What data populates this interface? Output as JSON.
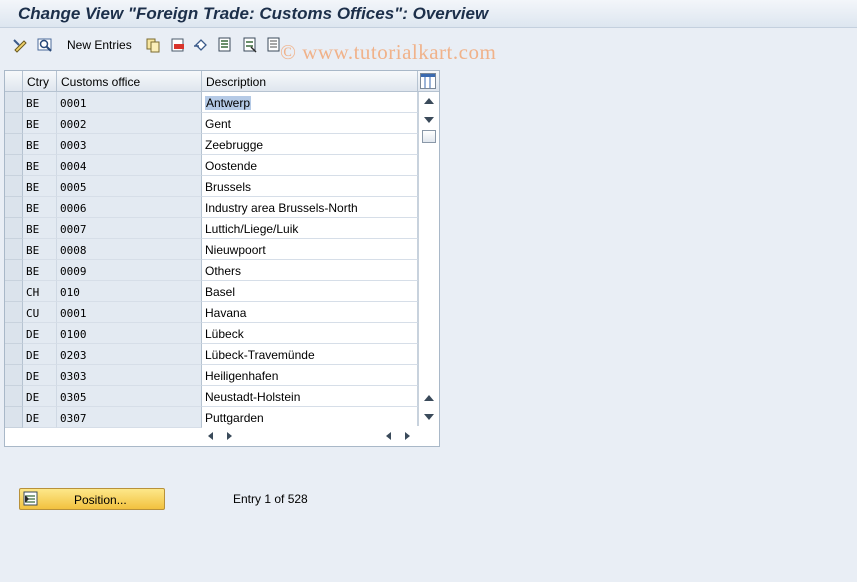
{
  "title": "Change View \"Foreign Trade: Customs Offices\": Overview",
  "toolbar": {
    "new_entries_label": "New Entries",
    "watermark": "© www.tutorialkart.com"
  },
  "table": {
    "headers": {
      "ctry": "Ctry",
      "office": "Customs office",
      "description": "Description"
    },
    "rows": [
      {
        "ctry": "BE",
        "office": "0001",
        "description": "Antwerp"
      },
      {
        "ctry": "BE",
        "office": "0002",
        "description": "Gent"
      },
      {
        "ctry": "BE",
        "office": "0003",
        "description": "Zeebrugge"
      },
      {
        "ctry": "BE",
        "office": "0004",
        "description": "Oostende"
      },
      {
        "ctry": "BE",
        "office": "0005",
        "description": "Brussels"
      },
      {
        "ctry": "BE",
        "office": "0006",
        "description": "Industry area Brussels-North"
      },
      {
        "ctry": "BE",
        "office": "0007",
        "description": "Luttich/Liege/Luik"
      },
      {
        "ctry": "BE",
        "office": "0008",
        "description": "Nieuwpoort"
      },
      {
        "ctry": "BE",
        "office": "0009",
        "description": "Others"
      },
      {
        "ctry": "CH",
        "office": "010",
        "description": "Basel"
      },
      {
        "ctry": "CU",
        "office": "0001",
        "description": "Havana"
      },
      {
        "ctry": "DE",
        "office": "0100",
        "description": "Lübeck"
      },
      {
        "ctry": "DE",
        "office": "0203",
        "description": "Lübeck-Travemünde"
      },
      {
        "ctry": "DE",
        "office": "0303",
        "description": "Heiligenhafen"
      },
      {
        "ctry": "DE",
        "office": "0305",
        "description": "Neustadt-Holstein"
      },
      {
        "ctry": "DE",
        "office": "0307",
        "description": "Puttgarden"
      }
    ]
  },
  "footer": {
    "position_label": "Position...",
    "entry_info": "Entry 1 of 528"
  },
  "colors": {
    "accent": "#f2c13f",
    "selection": "#b5cae6",
    "key_column": "#e3eaf2"
  }
}
